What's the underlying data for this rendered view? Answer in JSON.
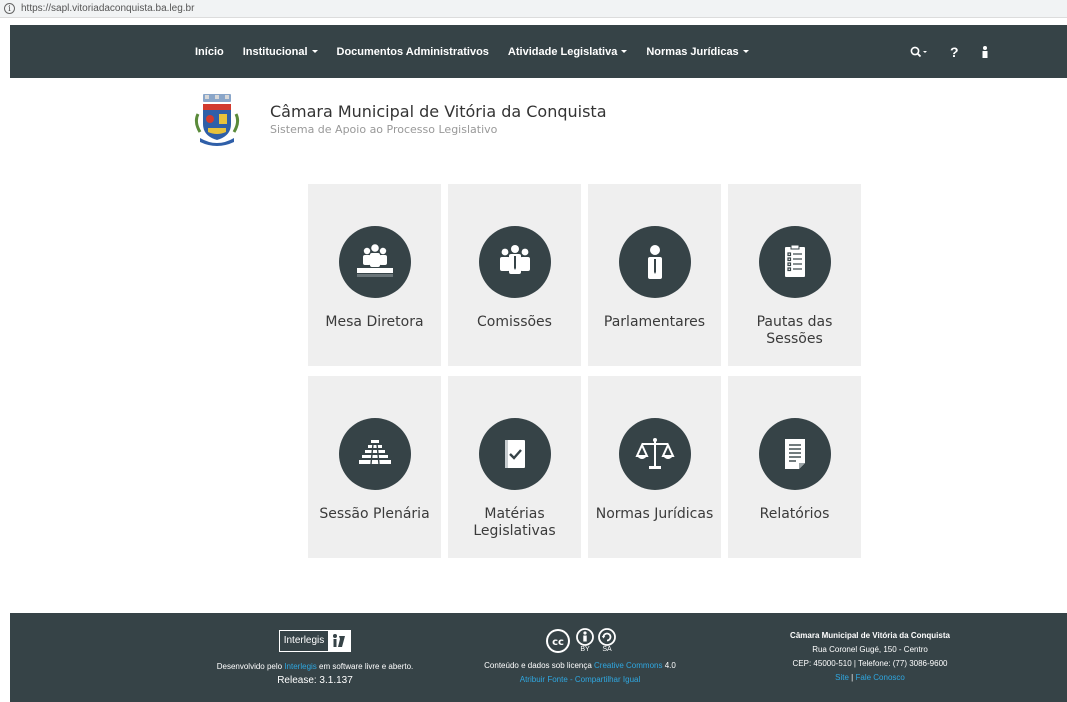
{
  "browser": {
    "url": "https://sapl.vitoriadaconquista.ba.leg.br"
  },
  "nav": {
    "items": [
      {
        "label": "Início",
        "dropdown": false
      },
      {
        "label": "Institucional",
        "dropdown": true
      },
      {
        "label": "Documentos Administrativos",
        "dropdown": false
      },
      {
        "label": "Atividade Legislativa",
        "dropdown": true
      },
      {
        "label": "Normas Jurídicas",
        "dropdown": true
      }
    ],
    "right_icons": [
      "search-icon",
      "help-icon",
      "user-icon"
    ],
    "help_label": "?"
  },
  "header": {
    "title": "Câmara Municipal de Vitória da Conquista",
    "subtitle": "Sistema de Apoio ao Processo Legislativo"
  },
  "cards": [
    {
      "label": "Mesa Diretora",
      "icon": "board-icon"
    },
    {
      "label": "Comissões",
      "icon": "committee-icon"
    },
    {
      "label": "Parlamentares",
      "icon": "parliamentarian-icon"
    },
    {
      "label": "Pautas das Sessões",
      "icon": "agenda-icon"
    },
    {
      "label": "Sessão Plenária",
      "icon": "plenary-icon"
    },
    {
      "label": "Matérias Legislativas",
      "icon": "legislative-matter-icon"
    },
    {
      "label": "Normas Jurídicas",
      "icon": "scales-icon"
    },
    {
      "label": "Relatórios",
      "icon": "report-icon"
    }
  ],
  "footer": {
    "interlegis_logo": "Interlegis",
    "dev_prefix": "Desenvolvido pelo ",
    "dev_link": "Interlegis",
    "dev_suffix": " em software livre e aberto.",
    "release": "Release: 3.1.137",
    "license_prefix": "Conteúdo e dados sob licença ",
    "license_link": "Creative Commons",
    "license_suffix": " 4.0",
    "license_terms": "Atribuir Fonte - Compartilhar Igual",
    "cc_by": "BY",
    "cc_sa": "SA",
    "org_name": "Câmara Municipal de Vitória da Conquista",
    "address": "Rua Coronel Gugé, 150 - Centro",
    "contact": "CEP: 45000-510 | Telefone: (77) 3086-9600",
    "site_link": "Site",
    "separator": " | ",
    "contact_link": "Fale Conosco"
  },
  "colors": {
    "nav_bg": "#364347",
    "card_bg": "#efefef",
    "link": "#2fa7e0"
  }
}
